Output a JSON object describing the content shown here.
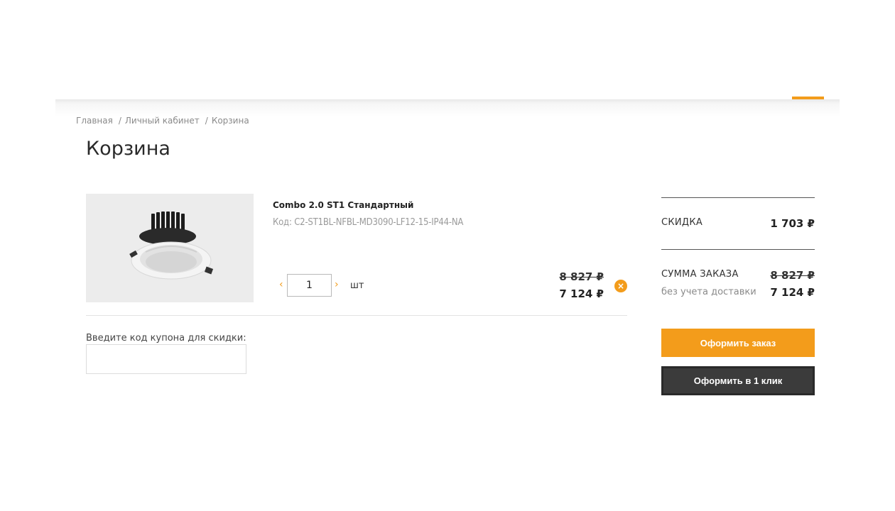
{
  "breadcrumb": {
    "items": [
      "Главная",
      "Личный кабинет",
      "Корзина"
    ],
    "separator": "/"
  },
  "page": {
    "title": "Корзина"
  },
  "cart": {
    "item": {
      "name": "Combo 2.0 ST1 Стандартный",
      "code": "Код: C2-ST1BL-NFBL-MD3090-LF12-15-IP44-NA",
      "quantity": "1",
      "unit": "шт",
      "price_old": "8 827 ₽",
      "price_new": "7 124 ₽",
      "dec_symbol": "‹",
      "inc_symbol": "›",
      "remove_symbol": "×"
    },
    "coupon_label": "Введите код купона для скидки:"
  },
  "summary": {
    "discount_label": "СКИДКА",
    "discount_value": "1 703 ₽",
    "total_label": "СУММА ЗАКАЗА",
    "total_sub": "без учета доставки",
    "total_old": "8 827 ₽",
    "total_new": "7 124 ₽",
    "order_button": "Оформить заказ",
    "oneclick_button": "Оформить в 1 клик"
  },
  "colors": {
    "accent": "#f39c1b",
    "dark_button": "#3b3b3b"
  }
}
